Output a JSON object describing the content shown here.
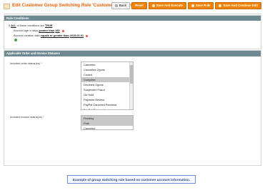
{
  "header": {
    "title": "Edit Customer Group Switching Rule 'Customer Account Age'",
    "buttons": [
      {
        "label": "Back",
        "style": "grey"
      },
      {
        "label": "Reset",
        "style": "orange"
      },
      {
        "label": "Save And Execute",
        "style": "orange"
      },
      {
        "label": "Save Rule",
        "style": "orange"
      },
      {
        "label": "Save And Continue Edit",
        "style": "orange"
      }
    ]
  },
  "conditions": {
    "legend": "Rule Conditions",
    "line1": {
      "prefix": "If",
      "aggregator": "ALL",
      "middle": "of these conditions are",
      "value": "TRUE",
      "suffix": ":"
    },
    "line2": {
      "attribute": "Account age in days",
      "operator": "greater than",
      "value": "180"
    },
    "line3": {
      "attribute": "Account creation date",
      "operator": "equals or greater than",
      "value": "2015-01-01"
    }
  },
  "statuses": {
    "legend": "Applicable Order and Invoice Statuses",
    "order_label": "Included order status(es)",
    "invoice_label": "Included invoice status(es)",
    "required_mark": "*",
    "order_options": [
      {
        "label": "Canceled",
        "selected": false
      },
      {
        "label": "Cancelled Ogone",
        "selected": false
      },
      {
        "label": "Closed",
        "selected": false
      },
      {
        "label": "Complete",
        "selected": true
      },
      {
        "label": "Declined Ogone",
        "selected": false
      },
      {
        "label": "Suspected Fraud",
        "selected": false
      },
      {
        "label": "On Hold",
        "selected": false
      },
      {
        "label": "Payment Review",
        "selected": false
      },
      {
        "label": "PayPal Canceled Reversal",
        "selected": false
      },
      {
        "label": "PayPal Reversed",
        "selected": false
      }
    ],
    "invoice_options": [
      {
        "label": "Pending",
        "selected": true
      },
      {
        "label": "Paid",
        "selected": true
      },
      {
        "label": "Canceled",
        "selected": false
      }
    ]
  },
  "caption": "Example of group switching rule based on customer account information.",
  "colors": {
    "accent": "#eb5e00",
    "button_orange": "#f18200",
    "legend_bg": "#6f8992",
    "caption_border": "#6f8ccf"
  }
}
